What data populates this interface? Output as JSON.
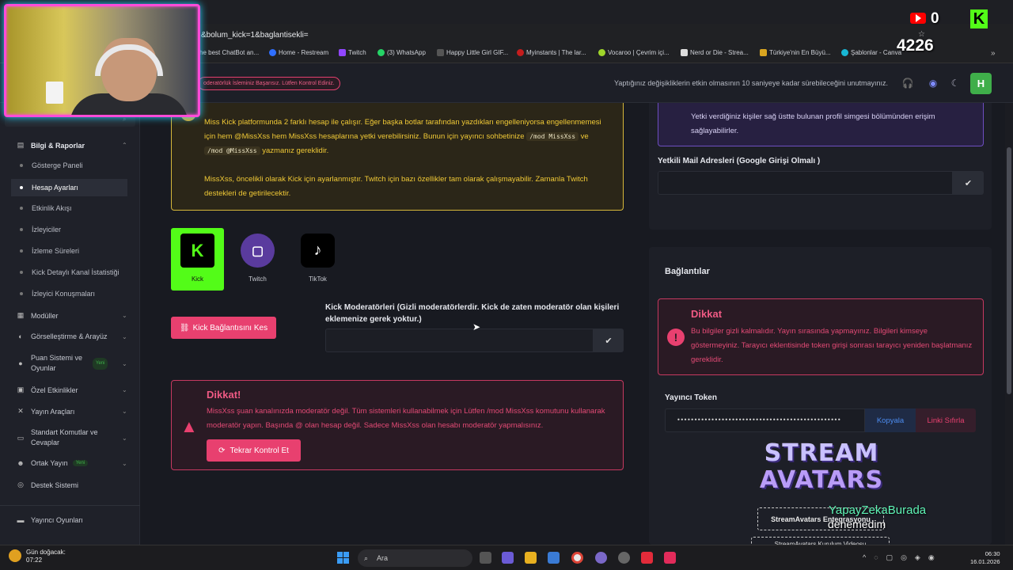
{
  "browser": {
    "url_fragment": "&bolum_kick=1&baglantisekli=",
    "bookmarks": [
      "he best ChatBot an...",
      "Home - Restream",
      "Twitch",
      "(3) WhatsApp",
      "Happy Little Girl GIF...",
      "Myinstants | The lar...",
      "Vocaroo | Çevrim içi...",
      "Nerd or Die - Strea...",
      "Türkiye'nin En Büyü...",
      "Şablonlar - Canva"
    ]
  },
  "header": {
    "mod_warning": "oderatörlük İsleminiz Başarısız. Lütfen Kontrol Ediniz.",
    "save_note": "Yaptığınız değişikliklerin etkin olmasının 10 saniyeye kadar sürebileceğini unutmayınız.",
    "avatar_letter": "H"
  },
  "sidebar": {
    "sections": [
      {
        "label": "Bilgi & Raporlar",
        "icon": "chart-icon"
      },
      {
        "label": "Modüller",
        "icon": "grid-icon"
      },
      {
        "label": "Görselleştirme & Arayüz",
        "icon": "palette-icon"
      },
      {
        "label": "Puan Sistemi ve Oyunlar",
        "icon": "coin-icon",
        "badge": "Yeni"
      },
      {
        "label": "Özel Etkinlikler",
        "icon": "calendar-icon"
      },
      {
        "label": "Yayın Araçları",
        "icon": "tools-icon"
      },
      {
        "label": "Standart Komutlar ve Cevaplar",
        "icon": "keyboard-icon"
      },
      {
        "label": "Ortak Yayın",
        "icon": "users-icon",
        "badge": "Yeni"
      },
      {
        "label": "Destek Sistemi",
        "icon": "support-icon"
      },
      {
        "label": "Yayıncı Oyunları",
        "icon": "gamepad-icon"
      }
    ],
    "sub_items": [
      "Gösterge Paneli",
      "Hesap Ayarları",
      "Etkinlik Akışı",
      "İzleyiciler",
      "İzleme Süreleri",
      "Kick Detaylı Kanal İstatistiği",
      "İzleyici Konuşmaları"
    ],
    "active_sub": "Hesap Ayarları"
  },
  "main": {
    "info": {
      "p1_a": "Miss Kick platformunda 2 farklı hesap ile çalışır. Eğer başka botlar tarafından yazdıkları engelleniyorsa engellenmemesi için hem @MissXss hem MissXss hesaplarına yetki verebilirsiniz. Bunun için yayıncı sohbetinize ",
      "code1": "/mod MissXss",
      "p1_b": " ve ",
      "code2": "/mod @MissXss",
      "p1_c": " yazmanız gereklidir.",
      "p2": "MissXss, öncelikli olarak Kick için ayarlanmıştır. Twitch için bazı özellikler tam olarak çalışmayabilir. Zamanla Twitch destekleri de getirilecektir."
    },
    "platforms": [
      {
        "label": "Kick",
        "active": true
      },
      {
        "label": "Twitch",
        "active": false
      },
      {
        "label": "TikTok",
        "active": false
      }
    ],
    "disconnect_label": "Kick Bağlantısını Kes",
    "mods_label": "Kick Moderatörleri (Gizli moderatörlerdir. Kick de zaten moderatör olan kişileri eklemenize gerek yoktur.)",
    "mods_value": "",
    "alert": {
      "title": "Dikkat!",
      "text": "MissXss şuan kanalınızda moderatör değil. Tüm sistemleri kullanabilmek için Lütfen /mod MissXss komutunu kullanarak moderatör yapın. Başında @ olan hesap değil. Sadece MissXss olan hesabı moderatör yapmalısınız.",
      "button": "Tekrar Kontrol Et"
    }
  },
  "right": {
    "purple_text": "Yetki verdiğiniz kişiler sağ üstte bulunan profil simgesi bölümünden erişim sağlayabilirler.",
    "mails_label": "Yetkili Mail Adresleri (Google Girişi Olmalı )",
    "mails_value": "",
    "connections_title": "Bağlantılar",
    "warn": {
      "title": "Dikkat",
      "text": "Bu bilgiler gizli kalmalıdır. Yayın sırasında yapmayınız. Bilgileri kimseye göstermeyiniz. Tarayıcı eklentisinde token girişi sonrası tarayıcı yeniden başlatmanız gereklidir."
    },
    "token_label": "Yayıncı Token",
    "token_value": "••••••••••••••••••••••••••••••••••••••••••••••••",
    "copy_label": "Kopyala",
    "reset_label": "Linki Sıfırla",
    "sa_logo_line1": "STREAM",
    "sa_logo_line2": "AVATARS",
    "sa_button": "StreamAvatars Entegrasyonu",
    "sa_button2": "StreamAvatars Kurulum Videosu"
  },
  "overlay": {
    "youtube_count": "0",
    "kick_count": "4226",
    "name": "YapayZekaBurada",
    "subtitle": "denemedim"
  },
  "taskbar": {
    "weather_title": "Gün doğacak:",
    "weather_time": "07:22",
    "search_placeholder": "Ara",
    "time": "06:30",
    "date": "16.01.2026"
  },
  "colors": {
    "accent": "#e8406f",
    "kick": "#53fc18",
    "warning": "#f0c936",
    "purple": "#6e4fc1"
  }
}
